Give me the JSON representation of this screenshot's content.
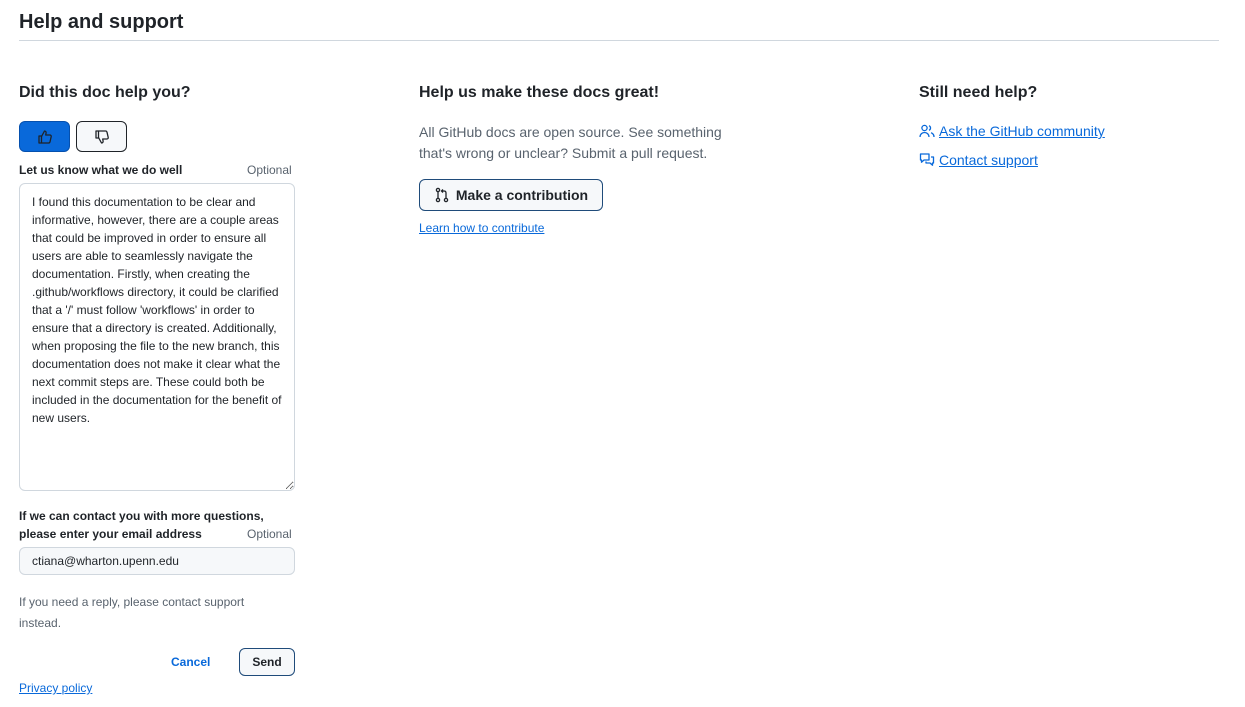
{
  "header": {
    "title": "Help and support"
  },
  "feedback": {
    "heading": "Did this doc help you?",
    "thumbs_up_icon": "thumbs-up-icon",
    "thumbs_down_icon": "thumbs-down-icon",
    "selected_vote": "yes",
    "textarea_label": "Let us know what we do well",
    "textarea_optional": "Optional",
    "textarea_value": "I found this documentation to be clear and informative, however, there are a couple areas that could be improved in order to ensure all users are able to seamlessly navigate the documentation. Firstly, when creating the .github/workflows directory, it could be clarified that a '/' must follow 'workflows' in order to ensure that a directory is created. Additionally, when proposing the file to the new branch, this documentation does not make it clear what the next commit steps are. These could both be included in the documentation for the benefit of new users.",
    "email_label": "If we can contact you with more questions, please enter your email address",
    "email_optional": "Optional",
    "email_value": "ctiana@wharton.upenn.edu",
    "reply_note": "If you need a reply, please contact support instead.",
    "cancel_label": "Cancel",
    "send_label": "Send",
    "privacy_label": "Privacy policy"
  },
  "contribute": {
    "heading": "Help us make these docs great!",
    "description": "All GitHub docs are open source. See something that's wrong or unclear? Submit a pull request.",
    "button_label": "Make a contribution",
    "button_icon": "git-pull-request-icon",
    "learn_label": "Learn how to contribute"
  },
  "still_need_help": {
    "heading": "Still need help?",
    "community_label": "Ask the GitHub community",
    "community_icon": "people-icon",
    "support_label": "Contact support",
    "support_icon": "comment-discussion-icon"
  },
  "colors": {
    "accent": "#0969da",
    "text": "#1f2328",
    "muted": "#59636e",
    "border": "#d0d7de"
  }
}
